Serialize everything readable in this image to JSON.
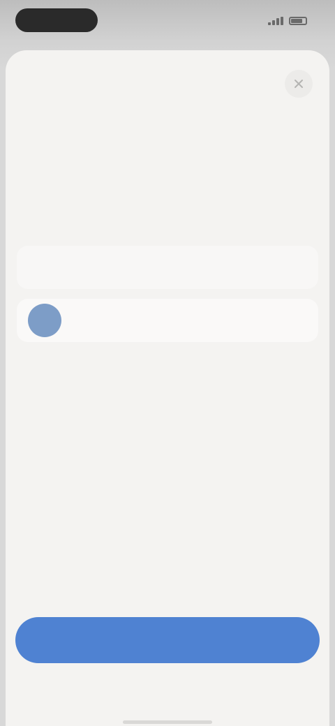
{
  "status_bar": {
    "time": ""
  },
  "sheet": {
    "title": "",
    "close_icon": "close-icon"
  },
  "options": [
    {
      "label": ""
    },
    {
      "label": "",
      "avatar_icon": "avatar"
    }
  ],
  "primary_button": {
    "label": ""
  },
  "colors": {
    "accent": "#4f82d2",
    "avatar": "#7d9dc7",
    "sheet_background": "#f4f3f1",
    "title_text": "#1f1f1f"
  }
}
